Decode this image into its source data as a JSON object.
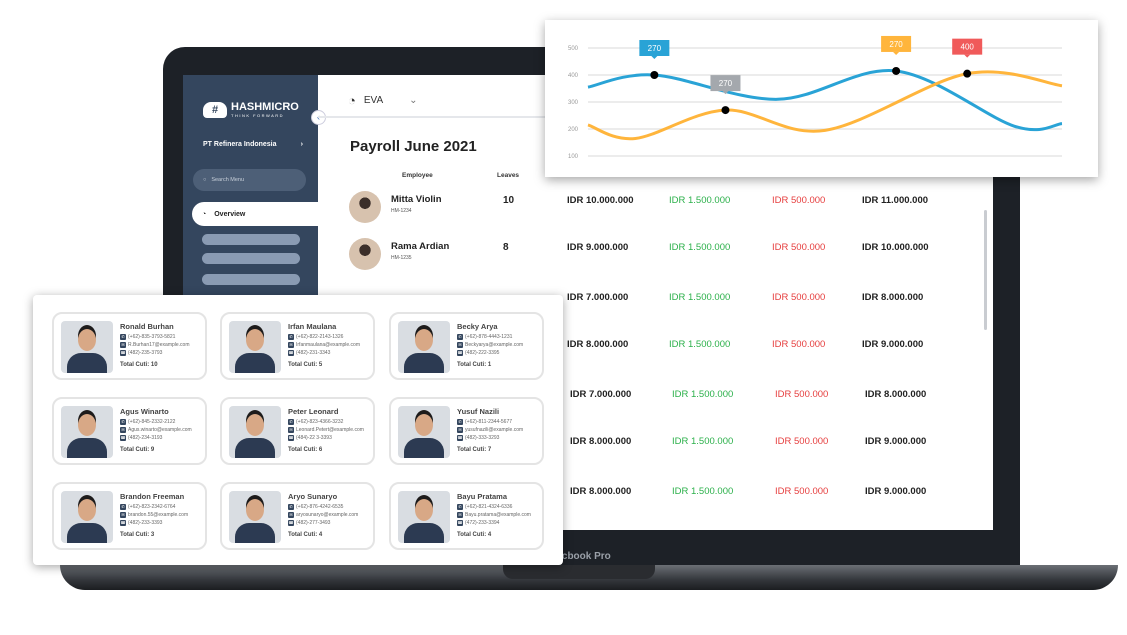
{
  "sidebar": {
    "logo": "HASHMICRO",
    "tagline": "THINK FORWARD",
    "company": "PT Refinera Indonesia",
    "search_placeholder": "Search Menu",
    "overview": "Overview"
  },
  "topbar": {
    "module": "EVA"
  },
  "payroll": {
    "title": "Payroll June 2021",
    "headers": {
      "employee": "Employee",
      "leaves": "Leaves"
    },
    "rows": [
      {
        "name": "Mitta Violin",
        "id": "HM-1234",
        "leaves": "10",
        "salary": "IDR  10.000.000",
        "allowance": "IDR 1.500.000",
        "deduction": "IDR 500.000",
        "total": "IDR 11.000.000"
      },
      {
        "name": "Rama Ardian",
        "id": "HM-1235",
        "leaves": "8",
        "salary": "IDR  9.000.000",
        "allowance": "IDR 1.500.000",
        "deduction": "IDR 500.000",
        "total": "IDR 10.000.000"
      },
      {
        "salary": "IDR  7.000.000",
        "allowance": "IDR 1.500.000",
        "deduction": "IDR 500.000",
        "total": "IDR 8.000.000"
      },
      {
        "salary": "IDR  8.000.000",
        "allowance": "IDR 1.500.000",
        "deduction": "IDR 500.000",
        "total": "IDR 9.000.000"
      },
      {
        "salary": "IDR  7.000.000",
        "allowance": "IDR 1.500.000",
        "deduction": "IDR 500.000",
        "total": "IDR 8.000.000"
      },
      {
        "salary": "IDR  8.000.000",
        "allowance": "IDR 1.500.000",
        "deduction": "IDR 500.000",
        "total": "IDR 9.000.000"
      },
      {
        "salary": "IDR  8.000.000",
        "allowance": "IDR 1.500.000",
        "deduction": "IDR 500.000",
        "total": "IDR 9.000.000"
      }
    ]
  },
  "device_label": "Macbook Pro",
  "employees": [
    {
      "name": "Ronald Burhan",
      "whatsapp": "(+62)-835-3793-5821",
      "email": "R.Burhan17@example.com",
      "phone": "(482)-235-3793",
      "cuti": "Total Cuti: 10"
    },
    {
      "name": "Irfan Maulana",
      "whatsapp": "(+62)-822-2143-1326",
      "email": "Irfanmaulana@example.com",
      "phone": "(482)-231-3343",
      "cuti": "Total Cuti: 5"
    },
    {
      "name": "Becky Arya",
      "whatsapp": "(+62)-878-4443-1231",
      "email": "Beckyarya@example.com",
      "phone": "(482)-222-3395",
      "cuti": "Total Cuti: 1"
    },
    {
      "name": "Agus Winarto",
      "whatsapp": "(+62)-845-2332-2122",
      "email": "Agus.winarto@example.com",
      "phone": "(482)-234-3193",
      "cuti": "Total Cuti: 9"
    },
    {
      "name": "Peter Leonard",
      "whatsapp": "(+62)-823-4366-3232",
      "email": "Leonard.Petert@example.com",
      "phone": "(484)-22 3-3393",
      "cuti": "Total Cuti: 6"
    },
    {
      "name": "Yusuf Nazili",
      "whatsapp": "(+62)-811-2344-5677",
      "email": "yusufnazili@example.com",
      "phone": "(482)-333-3293",
      "cuti": "Total Cuti: 7"
    },
    {
      "name": "Brandon Freeman",
      "whatsapp": "(+62)-823-2342-6764",
      "email": "brandon.55@example.com",
      "phone": "(482)-233-3393",
      "cuti": "Total Cuti: 3"
    },
    {
      "name": "Aryo Sunaryo",
      "whatsapp": "(+62)-876-4242-6535",
      "email": "aryosunaryo@example.com",
      "phone": "(482)-277-3493",
      "cuti": "Total Cuti: 4"
    },
    {
      "name": "Bayu Pratama",
      "whatsapp": "(+62)-821-4324-6336",
      "email": "Bayu.pratama@example.com",
      "phone": "(472)-233-3394",
      "cuti": "Total Cuti: 4"
    }
  ],
  "colors": {
    "sidebar": "#34465e",
    "allowance": "#2bb04a",
    "deduction": "#e63d3d",
    "series_blue": "#29a3d6",
    "series_orange": "#ffb53c"
  },
  "chart_data": {
    "type": "line",
    "ylim": [
      100,
      500
    ],
    "yticks": [
      "500",
      "400",
      "300",
      "200",
      "100"
    ],
    "grid": true,
    "xlim": [
      0,
      10
    ],
    "series": [
      {
        "color": "#29a3d6",
        "points": [
          [
            0,
            355
          ],
          [
            1.4,
            400
          ],
          [
            4,
            310
          ],
          [
            6.5,
            415
          ],
          [
            9,
            210
          ],
          [
            10,
            220
          ]
        ]
      },
      {
        "color": "#ffb53c",
        "points": [
          [
            0,
            215
          ],
          [
            1,
            165
          ],
          [
            2.9,
            270
          ],
          [
            5,
            195
          ],
          [
            8,
            405
          ],
          [
            10,
            360
          ]
        ]
      }
    ],
    "annotations": [
      {
        "series": 0,
        "x": 1.4,
        "y": 400,
        "label": "270",
        "color": "#29a3d6"
      },
      {
        "series": 1,
        "x": 2.9,
        "y": 270,
        "label": "270",
        "color": "#a4a8ad"
      },
      {
        "series": 0,
        "x": 6.5,
        "y": 415,
        "label": "270",
        "color": "#ffb53c"
      },
      {
        "series": 1,
        "x": 8,
        "y": 405,
        "label": "400",
        "color": "#f05a5a"
      }
    ]
  }
}
